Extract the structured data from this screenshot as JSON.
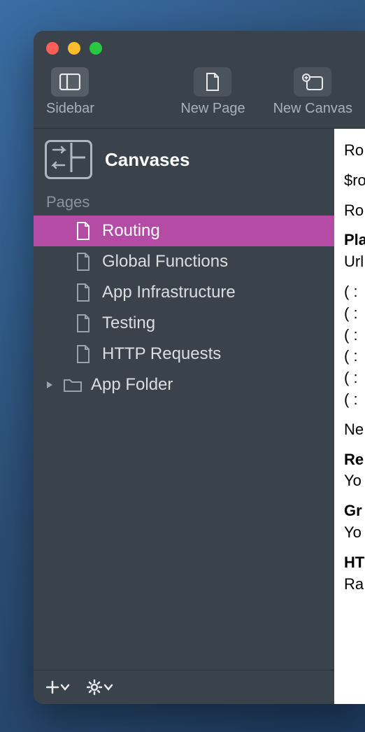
{
  "toolbar": {
    "sidebar_label": "Sidebar",
    "newpage_label": "New Page",
    "newcanvas_label": "New Canvas"
  },
  "sidebar": {
    "canvases_label": "Canvases",
    "section_label": "Pages",
    "pages": [
      {
        "label": "Routing"
      },
      {
        "label": "Global Functions"
      },
      {
        "label": "App Infrastructure"
      },
      {
        "label": "Testing"
      },
      {
        "label": "HTTP Requests"
      }
    ],
    "folder_label": "App Folder"
  },
  "content": {
    "l1": "Ro",
    "l2": "$ro",
    "l3": "Ro",
    "l4a": "Pla",
    "l4b": "Url",
    "p1": "( :",
    "p2": "( :",
    "p3": "( :",
    "p4": "( :",
    "p5": "( :",
    "p6": "( :",
    "l5": "Ne",
    "l6a": "Re",
    "l6b": "Yo",
    "l7a": "Gr",
    "l7b": "Yo",
    "l8a": "HT",
    "l8b": "Ra"
  }
}
